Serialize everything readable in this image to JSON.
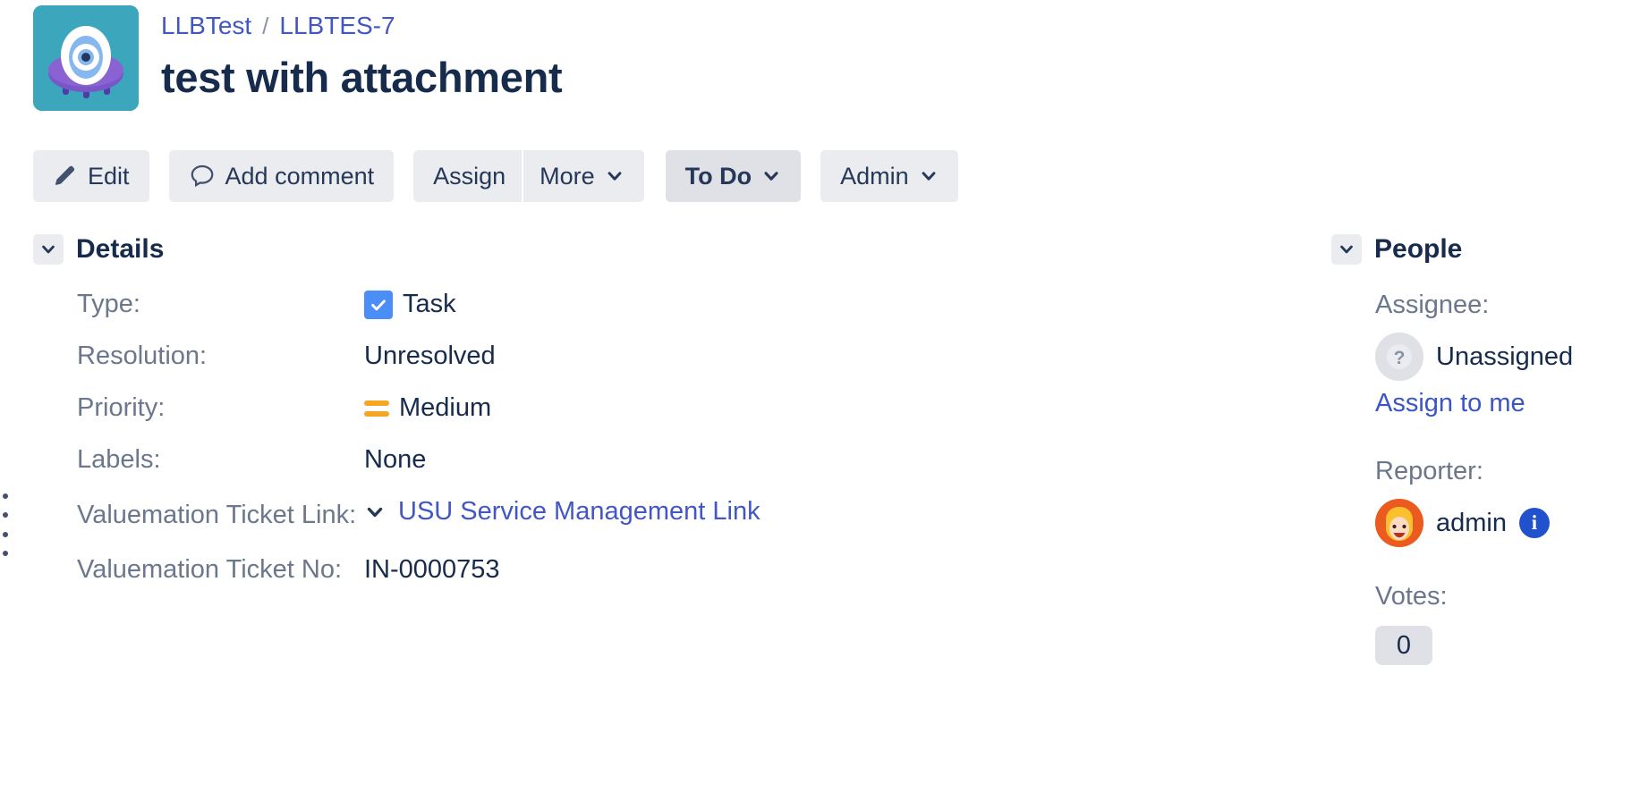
{
  "header": {
    "avatar_icon": "ufo-project-avatar",
    "breadcrumb": {
      "project": "LLBTest",
      "separator": "/",
      "issue_key": "LLBTES-7"
    },
    "title": "test with attachment"
  },
  "toolbar": {
    "edit_label": "Edit",
    "add_comment_label": "Add comment",
    "assign_label": "Assign",
    "more_label": "More",
    "status_label": "To Do",
    "admin_label": "Admin"
  },
  "details": {
    "section_title": "Details",
    "fields": [
      {
        "label": "Type:",
        "value": "Task",
        "kind": "type"
      },
      {
        "label": "Resolution:",
        "value": "Unresolved",
        "kind": "text"
      },
      {
        "label": "Priority:",
        "value": "Medium",
        "kind": "priority"
      },
      {
        "label": "Labels:",
        "value": "None",
        "kind": "text"
      },
      {
        "label": "Valuemation Ticket Link:",
        "value": "USU Service Management Link",
        "kind": "link"
      },
      {
        "label": "Valuemation Ticket No:",
        "value": "IN-0000753",
        "kind": "text"
      }
    ]
  },
  "people": {
    "section_title": "People",
    "assignee_label": "Assignee:",
    "assignee_value": "Unassigned",
    "assign_to_me_label": "Assign to me",
    "reporter_label": "Reporter:",
    "reporter_value": "admin",
    "reporter_info_glyph": "i",
    "votes_label": "Votes:",
    "votes_value": "0"
  },
  "colors": {
    "link": "#4256c5",
    "title": "#172B4D",
    "label": "#6b778c",
    "button_bg": "#ebecf0",
    "status_bg": "#dfe1e6",
    "priority_medium": "#f5a623",
    "type_task": "#4C8EF7",
    "avatar_bg": "#3ca6bd",
    "info_badge": "#2151cc"
  }
}
